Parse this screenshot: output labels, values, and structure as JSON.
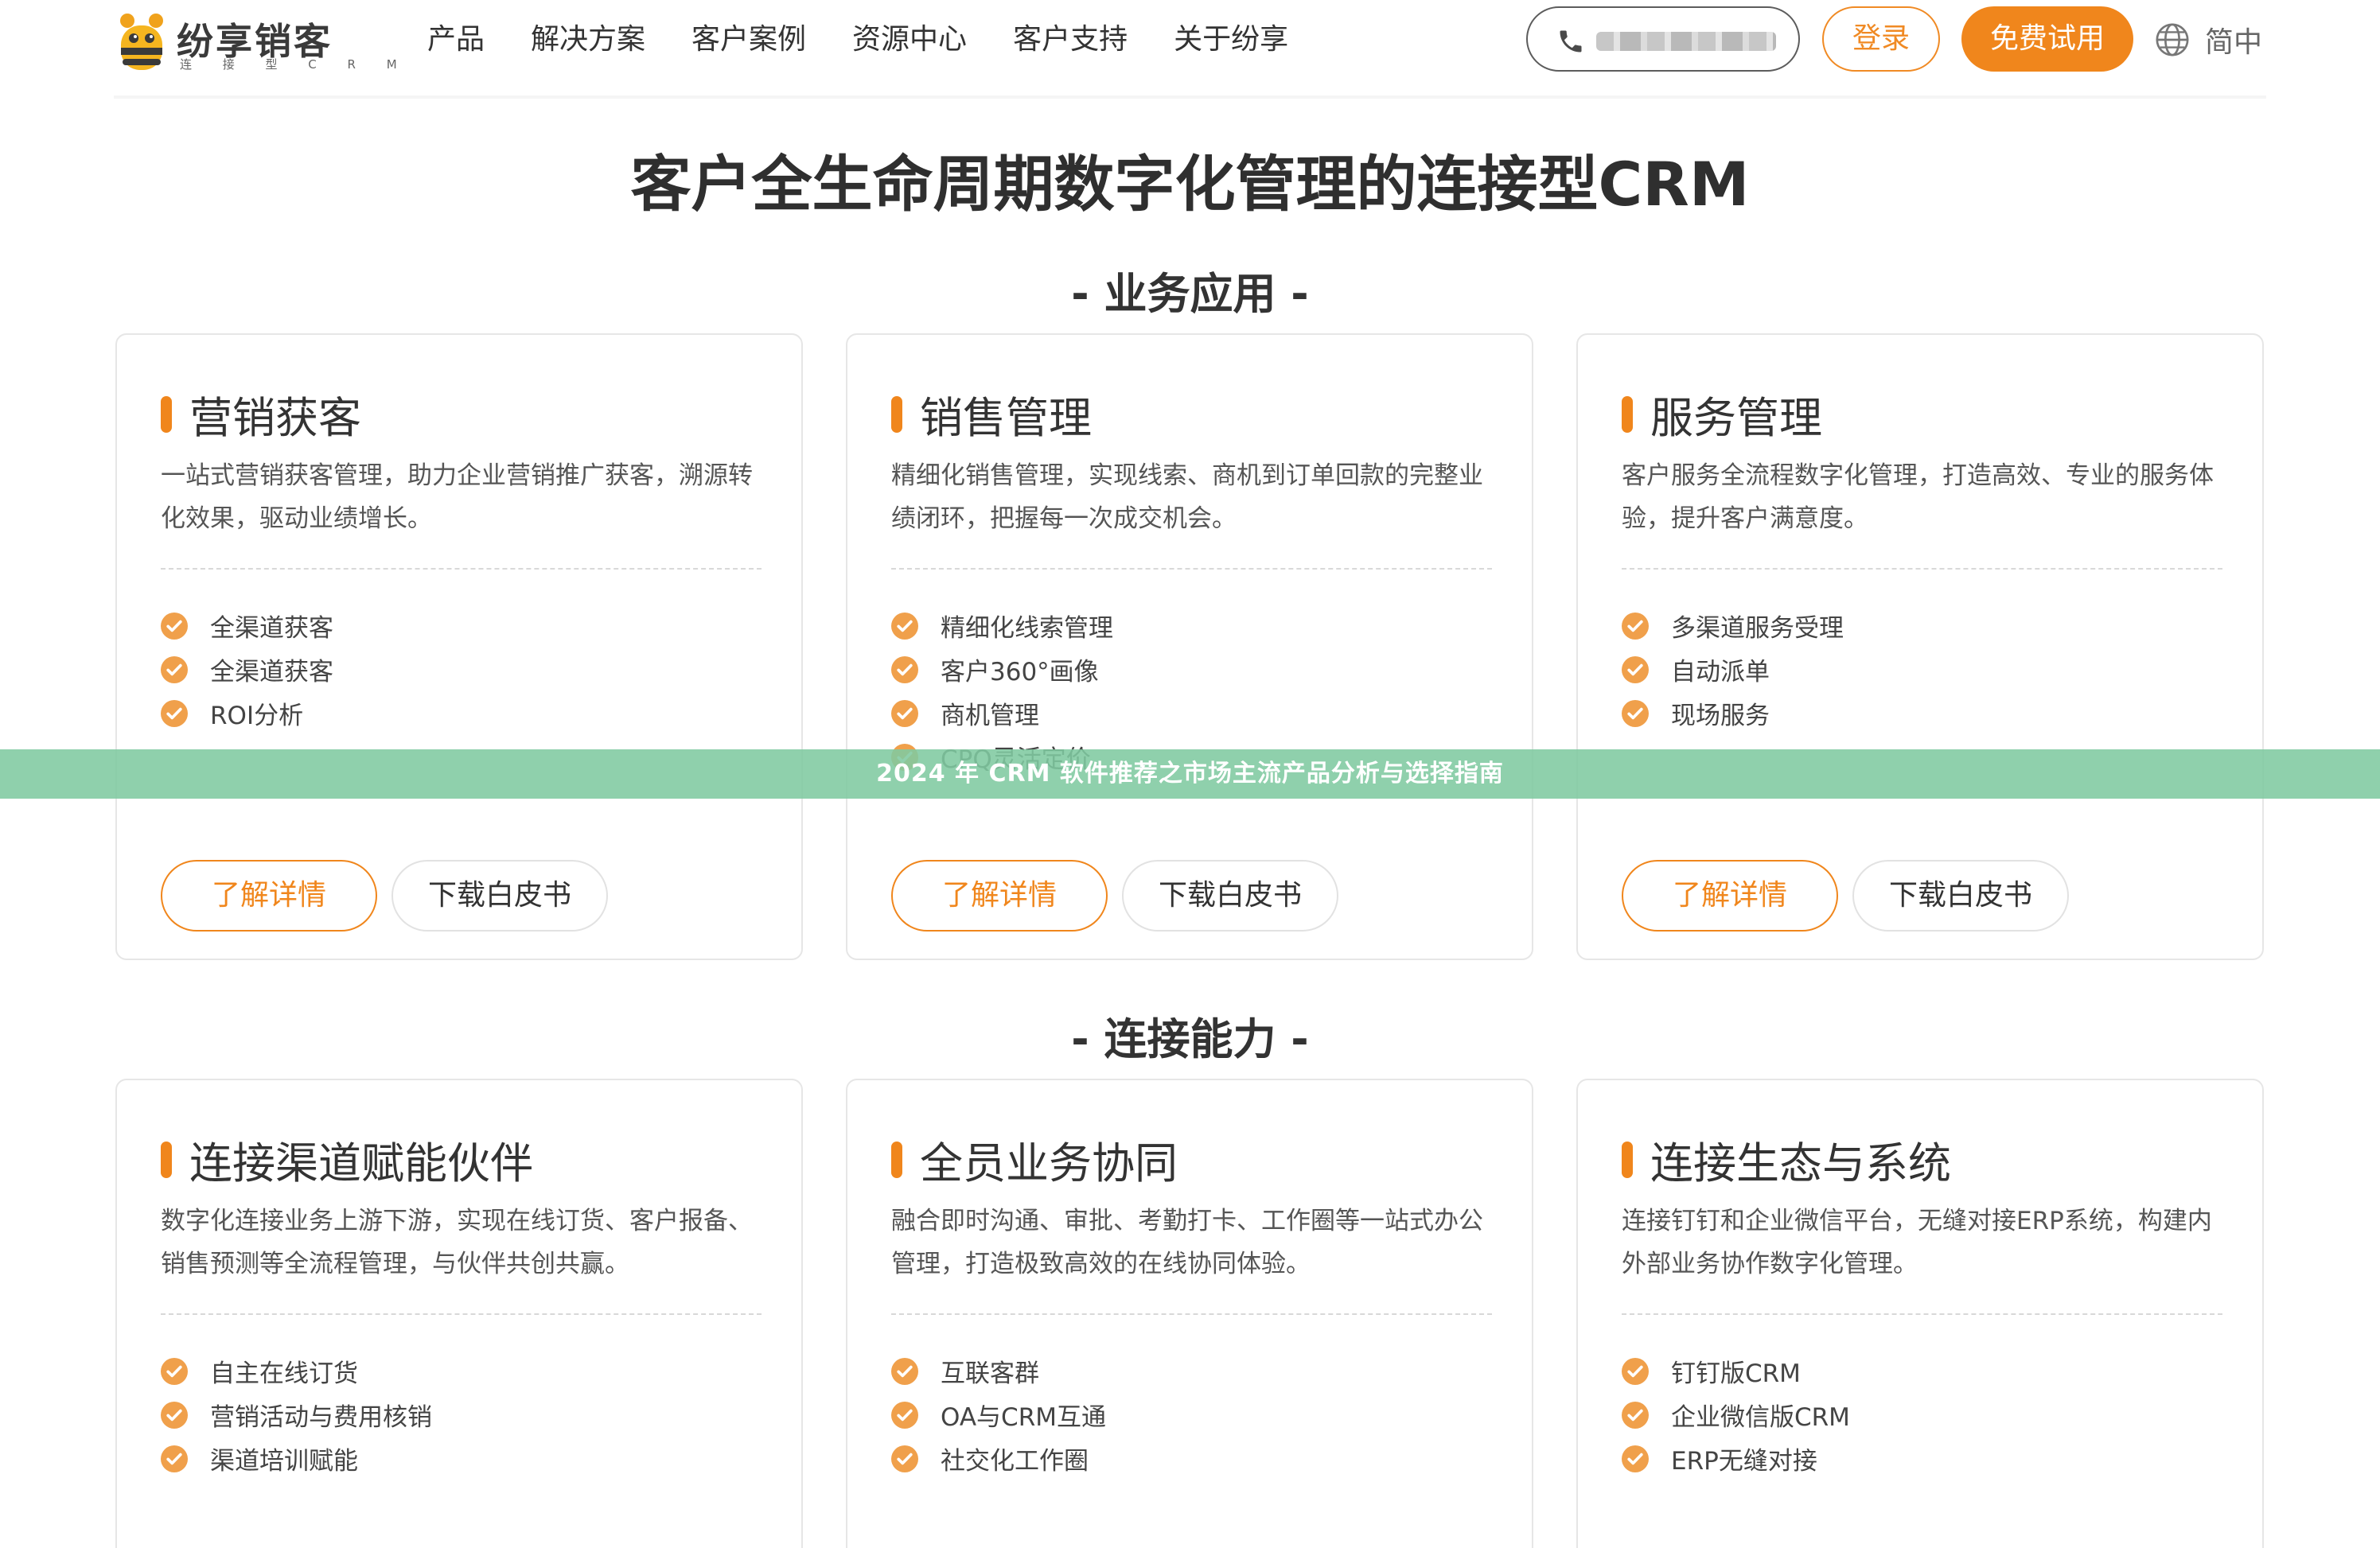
{
  "colors": {
    "accent": "#f0861c",
    "banner": "#7fc9a0"
  },
  "header": {
    "logo": {
      "name": "纷享销客",
      "sub": "连 接 型 C R M"
    },
    "nav": [
      "产品",
      "解决方案",
      "客户案例",
      "资源中心",
      "客户支持",
      "关于纷享"
    ],
    "login_label": "登录",
    "trial_label": "免费试用",
    "lang_label": "简中"
  },
  "page_title": "客户全生命周期数字化管理的连接型CRM",
  "sections": [
    {
      "title": "- 业务应用 -",
      "cards": [
        {
          "title": "营销获客",
          "desc": "一站式营销获客管理，助力企业营销推广获客，溯源转化效果，驱动业绩增长。",
          "features": [
            "全渠道获客",
            "全渠道获客",
            "ROI分析"
          ],
          "detail_label": "了解详情",
          "download_label": "下载白皮书"
        },
        {
          "title": "销售管理",
          "desc": "精细化销售管理，实现线索、商机到订单回款的完整业绩闭环，把握每一次成交机会。",
          "features": [
            "精细化线索管理",
            "客户360°画像",
            "商机管理",
            "CPQ灵活定价"
          ],
          "detail_label": "了解详情",
          "download_label": "下载白皮书"
        },
        {
          "title": "服务管理",
          "desc": "客户服务全流程数字化管理，打造高效、专业的服务体验，提升客户满意度。",
          "features": [
            "多渠道服务受理",
            "自动派单",
            "现场服务"
          ],
          "detail_label": "了解详情",
          "download_label": "下载白皮书"
        }
      ]
    },
    {
      "title": "- 连接能力 -",
      "cards": [
        {
          "title": "连接渠道赋能伙伴",
          "desc": "数字化连接业务上游下游，实现在线订货、客户报备、销售预测等全流程管理，与伙伴共创共赢。",
          "features": [
            "自主在线订货",
            "营销活动与费用核销",
            "渠道培训赋能"
          ]
        },
        {
          "title": "全员业务协同",
          "desc": "融合即时沟通、审批、考勤打卡、工作圈等一站式办公管理，打造极致高效的在线协同体验。",
          "features": [
            "互联客群",
            "OA与CRM互通",
            "社交化工作圈"
          ]
        },
        {
          "title": "连接生态与系统",
          "desc": "连接钉钉和企业微信平台，无缝对接ERP系统，构建内外部业务协作数字化管理。",
          "features": [
            "钉钉版CRM",
            "企业微信版CRM",
            "ERP无缝对接"
          ]
        }
      ]
    }
  ],
  "banner_text": "2024 年 CRM 软件推荐之市场主流产品分析与选择指南"
}
